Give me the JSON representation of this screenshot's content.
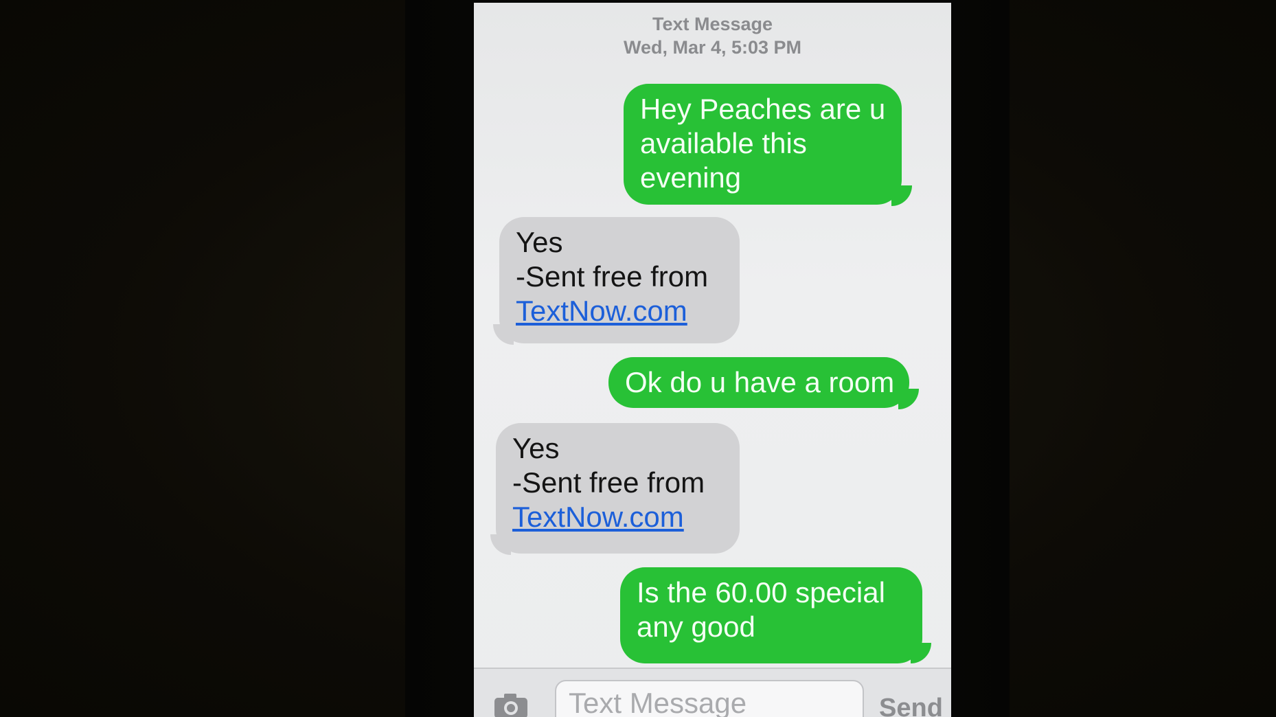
{
  "header": {
    "service": "Text Message",
    "timestamp": "Wed, Mar 4, 5:03 PM"
  },
  "messages": [
    {
      "direction": "sent",
      "lines": [
        "Hey Peaches are u",
        "available this",
        "evening"
      ]
    },
    {
      "direction": "received",
      "lines": [
        "Yes",
        "-Sent free from"
      ],
      "link": "TextNow.com"
    },
    {
      "direction": "sent",
      "lines": [
        "Ok do u have a room"
      ]
    },
    {
      "direction": "received",
      "lines": [
        "Yes",
        "-Sent free from"
      ],
      "link": "TextNow.com"
    },
    {
      "direction": "sent",
      "lines": [
        "Is the 60.00 special",
        "any good"
      ]
    }
  ],
  "composer": {
    "placeholder": "Text Message",
    "send_label": "Send",
    "camera_icon": "camera-icon"
  },
  "colors": {
    "sent_bubble": "#28c136",
    "received_bubble": "#d2d2d4",
    "link": "#1c5fd9"
  }
}
